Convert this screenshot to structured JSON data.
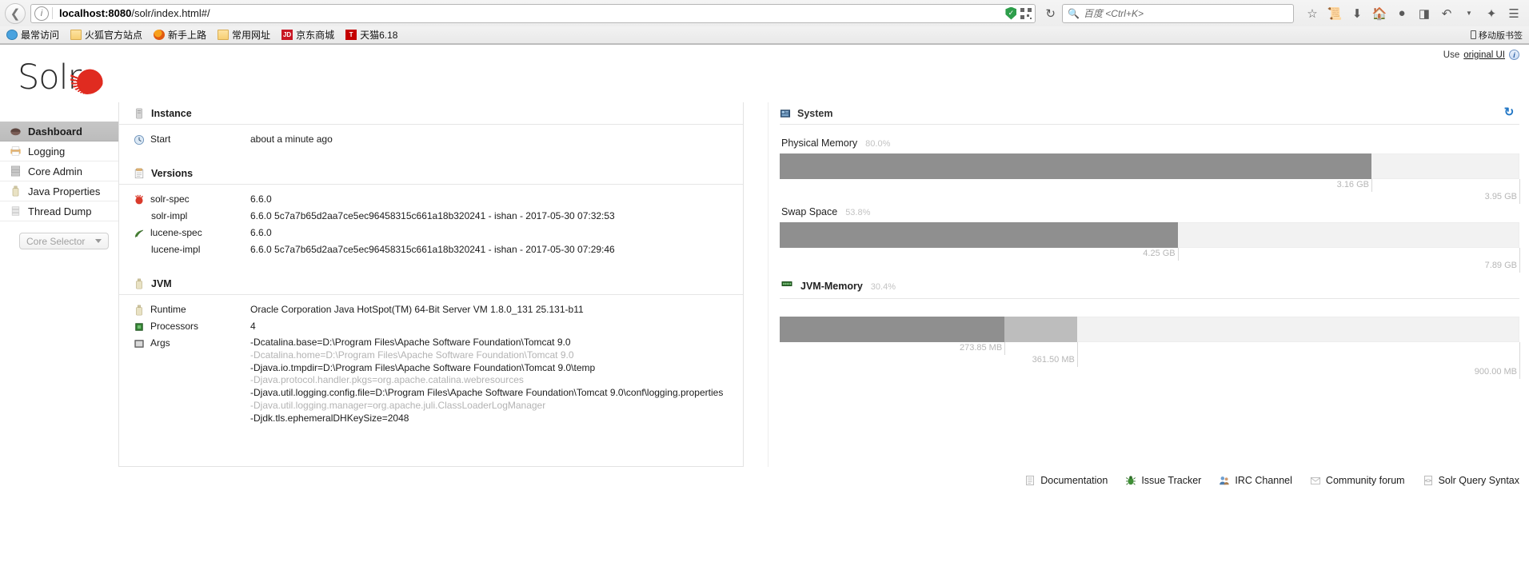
{
  "browser": {
    "back_icon": "back-arrow-icon",
    "info_icon": "page-info-icon",
    "url_host": "localhost:8080",
    "url_path": "/solr/index.html#/",
    "reload_icon": "reload-icon",
    "shield_icon": "shield-icon",
    "qr_icon": "qr-code-icon",
    "search_placeholder": "百度 <Ctrl+K>",
    "toolbar_icons": [
      "star-icon",
      "library-icon",
      "download-icon",
      "home-icon",
      "pocket-icon",
      "screenshot-icon",
      "sync-icon",
      "dropdown-icon",
      "addon-icon",
      "menu-icon"
    ],
    "bookmarks": [
      {
        "label": "最常访问",
        "icon": "most-visited-icon"
      },
      {
        "label": "火狐官方站点",
        "icon": "folder-icon"
      },
      {
        "label": "新手上路",
        "icon": "firefox-icon"
      },
      {
        "label": "常用网址",
        "icon": "folder-icon"
      },
      {
        "label": "京东商城",
        "icon": "jd-icon"
      },
      {
        "label": "天猫6.18",
        "icon": "tmall-icon"
      }
    ],
    "mobile_bookmarks": "移动版书签"
  },
  "app": {
    "use_original_prefix": "Use",
    "use_original_link": "original UI",
    "logo_text": "Solr",
    "core_selector": "Core Selector"
  },
  "sidebar": {
    "items": [
      {
        "label": "Dashboard",
        "icon": "dashboard-icon",
        "active": true
      },
      {
        "label": "Logging",
        "icon": "logging-icon",
        "active": false
      },
      {
        "label": "Core Admin",
        "icon": "core-admin-icon",
        "active": false
      },
      {
        "label": "Java Properties",
        "icon": "java-properties-icon",
        "active": false
      },
      {
        "label": "Thread Dump",
        "icon": "thread-dump-icon",
        "active": false
      }
    ]
  },
  "instance": {
    "title": "Instance",
    "icon": "server-icon",
    "rows": [
      {
        "key": "Start",
        "icon": "clock-icon",
        "value": "about a minute ago"
      }
    ]
  },
  "versions": {
    "title": "Versions",
    "icon": "versions-icon",
    "rows": [
      {
        "key": "solr-spec",
        "icon": "solr-icon",
        "indent": false,
        "value": "6.6.0"
      },
      {
        "key": "solr-impl",
        "icon": "",
        "indent": true,
        "value": "6.6.0 5c7a7b65d2aa7ce5ec96458315c661a18b320241 - ishan - 2017-05-30 07:32:53"
      },
      {
        "key": "lucene-spec",
        "icon": "lucene-icon",
        "indent": false,
        "value": "6.6.0"
      },
      {
        "key": "lucene-impl",
        "icon": "",
        "indent": true,
        "value": "6.6.0 5c7a7b65d2aa7ce5ec96458315c661a18b320241 - ishan - 2017-05-30 07:29:46"
      }
    ]
  },
  "jvm": {
    "title": "JVM",
    "icon": "jvm-icon",
    "runtime_key": "Runtime",
    "runtime_value": "Oracle Corporation Java HotSpot(TM) 64-Bit Server VM 1.8.0_131 25.131-b11",
    "processors_key": "Processors",
    "processors_value": "4",
    "args_key": "Args",
    "args": [
      {
        "text": "-Dcatalina.base=D:\\Program Files\\Apache Software Foundation\\Tomcat 9.0",
        "dim": false
      },
      {
        "text": "-Dcatalina.home=D:\\Program Files\\Apache Software Foundation\\Tomcat 9.0",
        "dim": true
      },
      {
        "text": "-Djava.io.tmpdir=D:\\Program Files\\Apache Software Foundation\\Tomcat 9.0\\temp",
        "dim": false
      },
      {
        "text": "-Djava.protocol.handler.pkgs=org.apache.catalina.webresources",
        "dim": true
      },
      {
        "text": "-Djava.util.logging.config.file=D:\\Program Files\\Apache Software Foundation\\Tomcat 9.0\\conf\\logging.properties",
        "dim": false
      },
      {
        "text": "-Djava.util.logging.manager=org.apache.juli.ClassLoaderLogManager",
        "dim": true
      },
      {
        "text": "-Djdk.tls.ephemeralDHKeySize=2048",
        "dim": false
      }
    ]
  },
  "system": {
    "title": "System",
    "icon": "system-icon",
    "refresh_icon": "refresh-icon",
    "meters": [
      {
        "label": "Physical Memory",
        "icon": "",
        "bold": false,
        "percent_label": "80.0%",
        "percent": 80.0,
        "ticks": [
          {
            "label": "3.16 GB",
            "pos": 80.0,
            "level": 1
          },
          {
            "label": "3.95 GB",
            "pos": 100.0,
            "level": 2
          }
        ]
      },
      {
        "label": "Swap Space",
        "icon": "",
        "bold": false,
        "percent_label": "53.8%",
        "percent": 53.8,
        "ticks": [
          {
            "label": "4.25 GB",
            "pos": 53.8,
            "level": 1
          },
          {
            "label": "7.89 GB",
            "pos": 100.0,
            "level": 2
          }
        ]
      },
      {
        "label": "JVM-Memory",
        "icon": "memory-icon",
        "bold": true,
        "percent_label": "30.4%",
        "percent": 30.4,
        "percent_mid": 40.2,
        "ticks": [
          {
            "label": "273.85 MB",
            "pos": 30.4,
            "level": 1
          },
          {
            "label": "361.50 MB",
            "pos": 40.2,
            "level": 2
          },
          {
            "label": "900.00 MB",
            "pos": 100.0,
            "level": 3
          }
        ]
      }
    ]
  },
  "footer": {
    "links": [
      {
        "label": "Documentation",
        "icon": "document-icon"
      },
      {
        "label": "Issue Tracker",
        "icon": "bug-icon"
      },
      {
        "label": "IRC Channel",
        "icon": "users-icon"
      },
      {
        "label": "Community forum",
        "icon": "mail-icon"
      },
      {
        "label": "Solr Query Syntax",
        "icon": "code-icon"
      }
    ]
  },
  "colors": {
    "solr_red": "#e02b20",
    "bar_dark": "#8f8f8f",
    "bar_mid": "#bdbdbd",
    "bar_track": "#f2f2f2",
    "nav_active": "#c0c0c0"
  }
}
